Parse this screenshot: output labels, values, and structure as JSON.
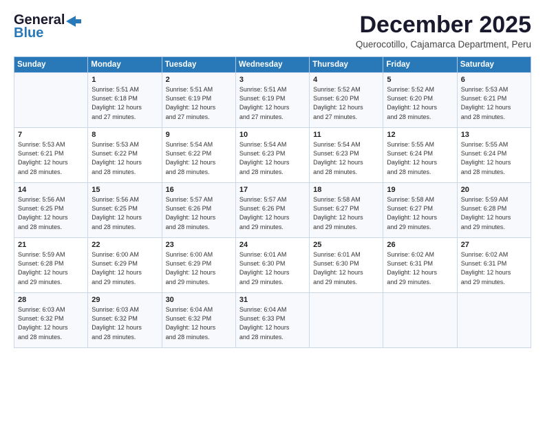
{
  "header": {
    "logo_general": "General",
    "logo_blue": "Blue",
    "title": "December 2025",
    "location": "Querocotillo, Cajamarca Department, Peru"
  },
  "days_of_week": [
    "Sunday",
    "Monday",
    "Tuesday",
    "Wednesday",
    "Thursday",
    "Friday",
    "Saturday"
  ],
  "weeks": [
    [
      {
        "day": "",
        "sunrise": "",
        "sunset": "",
        "daylight": ""
      },
      {
        "day": "1",
        "sunrise": "Sunrise: 5:51 AM",
        "sunset": "Sunset: 6:18 PM",
        "daylight": "Daylight: 12 hours and 27 minutes."
      },
      {
        "day": "2",
        "sunrise": "Sunrise: 5:51 AM",
        "sunset": "Sunset: 6:19 PM",
        "daylight": "Daylight: 12 hours and 27 minutes."
      },
      {
        "day": "3",
        "sunrise": "Sunrise: 5:51 AM",
        "sunset": "Sunset: 6:19 PM",
        "daylight": "Daylight: 12 hours and 27 minutes."
      },
      {
        "day": "4",
        "sunrise": "Sunrise: 5:52 AM",
        "sunset": "Sunset: 6:20 PM",
        "daylight": "Daylight: 12 hours and 27 minutes."
      },
      {
        "day": "5",
        "sunrise": "Sunrise: 5:52 AM",
        "sunset": "Sunset: 6:20 PM",
        "daylight": "Daylight: 12 hours and 28 minutes."
      },
      {
        "day": "6",
        "sunrise": "Sunrise: 5:53 AM",
        "sunset": "Sunset: 6:21 PM",
        "daylight": "Daylight: 12 hours and 28 minutes."
      }
    ],
    [
      {
        "day": "7",
        "sunrise": "Sunrise: 5:53 AM",
        "sunset": "Sunset: 6:21 PM",
        "daylight": "Daylight: 12 hours and 28 minutes."
      },
      {
        "day": "8",
        "sunrise": "Sunrise: 5:53 AM",
        "sunset": "Sunset: 6:22 PM",
        "daylight": "Daylight: 12 hours and 28 minutes."
      },
      {
        "day": "9",
        "sunrise": "Sunrise: 5:54 AM",
        "sunset": "Sunset: 6:22 PM",
        "daylight": "Daylight: 12 hours and 28 minutes."
      },
      {
        "day": "10",
        "sunrise": "Sunrise: 5:54 AM",
        "sunset": "Sunset: 6:23 PM",
        "daylight": "Daylight: 12 hours and 28 minutes."
      },
      {
        "day": "11",
        "sunrise": "Sunrise: 5:54 AM",
        "sunset": "Sunset: 6:23 PM",
        "daylight": "Daylight: 12 hours and 28 minutes."
      },
      {
        "day": "12",
        "sunrise": "Sunrise: 5:55 AM",
        "sunset": "Sunset: 6:24 PM",
        "daylight": "Daylight: 12 hours and 28 minutes."
      },
      {
        "day": "13",
        "sunrise": "Sunrise: 5:55 AM",
        "sunset": "Sunset: 6:24 PM",
        "daylight": "Daylight: 12 hours and 28 minutes."
      }
    ],
    [
      {
        "day": "14",
        "sunrise": "Sunrise: 5:56 AM",
        "sunset": "Sunset: 6:25 PM",
        "daylight": "Daylight: 12 hours and 28 minutes."
      },
      {
        "day": "15",
        "sunrise": "Sunrise: 5:56 AM",
        "sunset": "Sunset: 6:25 PM",
        "daylight": "Daylight: 12 hours and 28 minutes."
      },
      {
        "day": "16",
        "sunrise": "Sunrise: 5:57 AM",
        "sunset": "Sunset: 6:26 PM",
        "daylight": "Daylight: 12 hours and 28 minutes."
      },
      {
        "day": "17",
        "sunrise": "Sunrise: 5:57 AM",
        "sunset": "Sunset: 6:26 PM",
        "daylight": "Daylight: 12 hours and 29 minutes."
      },
      {
        "day": "18",
        "sunrise": "Sunrise: 5:58 AM",
        "sunset": "Sunset: 6:27 PM",
        "daylight": "Daylight: 12 hours and 29 minutes."
      },
      {
        "day": "19",
        "sunrise": "Sunrise: 5:58 AM",
        "sunset": "Sunset: 6:27 PM",
        "daylight": "Daylight: 12 hours and 29 minutes."
      },
      {
        "day": "20",
        "sunrise": "Sunrise: 5:59 AM",
        "sunset": "Sunset: 6:28 PM",
        "daylight": "Daylight: 12 hours and 29 minutes."
      }
    ],
    [
      {
        "day": "21",
        "sunrise": "Sunrise: 5:59 AM",
        "sunset": "Sunset: 6:28 PM",
        "daylight": "Daylight: 12 hours and 29 minutes."
      },
      {
        "day": "22",
        "sunrise": "Sunrise: 6:00 AM",
        "sunset": "Sunset: 6:29 PM",
        "daylight": "Daylight: 12 hours and 29 minutes."
      },
      {
        "day": "23",
        "sunrise": "Sunrise: 6:00 AM",
        "sunset": "Sunset: 6:29 PM",
        "daylight": "Daylight: 12 hours and 29 minutes."
      },
      {
        "day": "24",
        "sunrise": "Sunrise: 6:01 AM",
        "sunset": "Sunset: 6:30 PM",
        "daylight": "Daylight: 12 hours and 29 minutes."
      },
      {
        "day": "25",
        "sunrise": "Sunrise: 6:01 AM",
        "sunset": "Sunset: 6:30 PM",
        "daylight": "Daylight: 12 hours and 29 minutes."
      },
      {
        "day": "26",
        "sunrise": "Sunrise: 6:02 AM",
        "sunset": "Sunset: 6:31 PM",
        "daylight": "Daylight: 12 hours and 29 minutes."
      },
      {
        "day": "27",
        "sunrise": "Sunrise: 6:02 AM",
        "sunset": "Sunset: 6:31 PM",
        "daylight": "Daylight: 12 hours and 29 minutes."
      }
    ],
    [
      {
        "day": "28",
        "sunrise": "Sunrise: 6:03 AM",
        "sunset": "Sunset: 6:32 PM",
        "daylight": "Daylight: 12 hours and 28 minutes."
      },
      {
        "day": "29",
        "sunrise": "Sunrise: 6:03 AM",
        "sunset": "Sunset: 6:32 PM",
        "daylight": "Daylight: 12 hours and 28 minutes."
      },
      {
        "day": "30",
        "sunrise": "Sunrise: 6:04 AM",
        "sunset": "Sunset: 6:32 PM",
        "daylight": "Daylight: 12 hours and 28 minutes."
      },
      {
        "day": "31",
        "sunrise": "Sunrise: 6:04 AM",
        "sunset": "Sunset: 6:33 PM",
        "daylight": "Daylight: 12 hours and 28 minutes."
      },
      {
        "day": "",
        "sunrise": "",
        "sunset": "",
        "daylight": ""
      },
      {
        "day": "",
        "sunrise": "",
        "sunset": "",
        "daylight": ""
      },
      {
        "day": "",
        "sunrise": "",
        "sunset": "",
        "daylight": ""
      }
    ]
  ]
}
